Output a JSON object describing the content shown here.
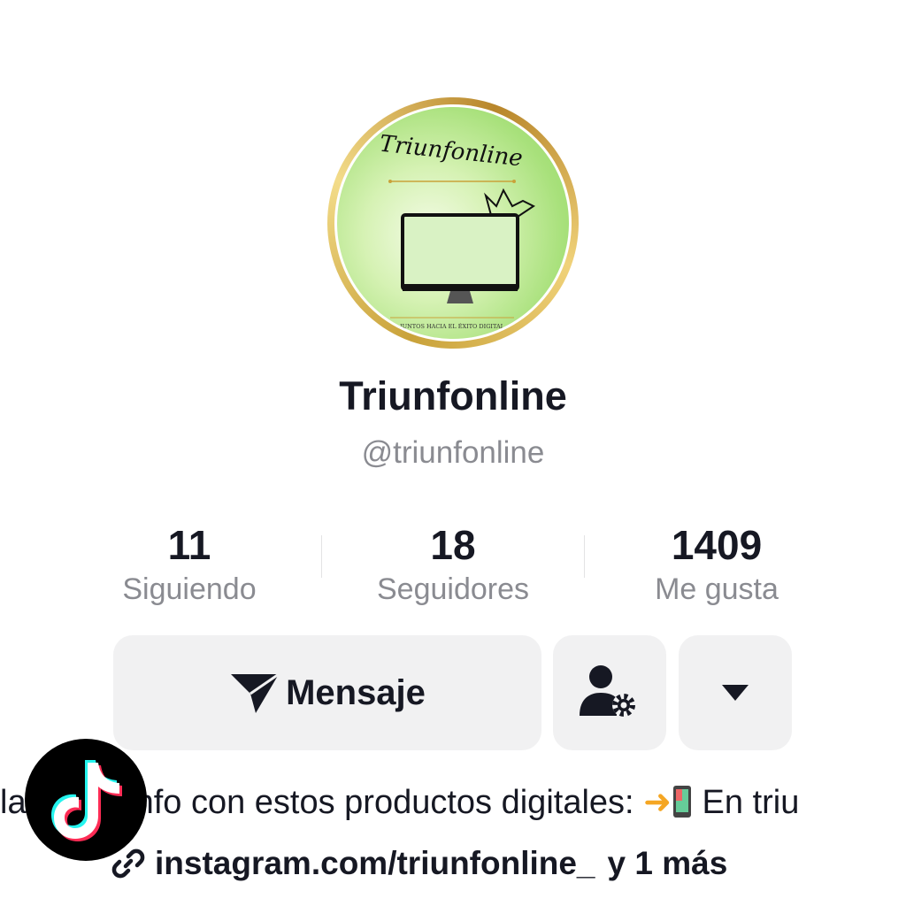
{
  "profile": {
    "avatar_title": "Triunfonline",
    "avatar_caption": "JUNTOS HACIA EL ÉXITO DIGITAL",
    "display_name": "Triunfonline",
    "username": "@triunfonline"
  },
  "stats": [
    {
      "value": "11",
      "label": "Siguiendo"
    },
    {
      "value": "18",
      "label": "Seguidores"
    },
    {
      "value": "1409",
      "label": "Me gusta"
    }
  ],
  "actions": {
    "message_label": "Mensaje"
  },
  "bio": {
    "text_before": "la",
    "text_after": "nfo con estos productos digitales: ",
    "text_end": " En triu"
  },
  "link": {
    "url": "instagram.com/triunfonline_",
    "more": "y 1 más"
  },
  "colors": {
    "text_primary": "#161823",
    "text_secondary": "#8a8b91",
    "button_bg": "#f1f1f2",
    "tiktok_cyan": "#25f4ee",
    "tiktok_red": "#fe2c55"
  }
}
